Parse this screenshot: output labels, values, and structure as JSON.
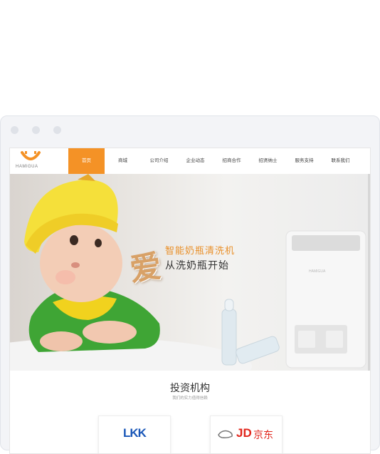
{
  "window": {
    "controls": [
      "close",
      "minimize",
      "maximize"
    ]
  },
  "logo": {
    "text": "HAMIGUA",
    "icon": "smile-logo-icon",
    "color": "#f49226"
  },
  "nav": {
    "items": [
      {
        "label": "首页",
        "active": true
      },
      {
        "label": "商城"
      },
      {
        "label": "公司介绍"
      },
      {
        "label": "企业动态"
      },
      {
        "label": "招商合作"
      },
      {
        "label": "招贤纳士"
      },
      {
        "label": "服务支持"
      },
      {
        "label": "联系我们"
      }
    ],
    "active_color": "#f49226"
  },
  "banner": {
    "love_char": "爱",
    "headline": "智能奶瓶清洗机",
    "subline": "从洗奶瓶开始",
    "machine_brand": "HAMIGUA"
  },
  "section": {
    "title": "投资机构",
    "subtitle": "我们的实力值得信赖"
  },
  "partners": [
    {
      "name": "LKK",
      "color": "#1a57b8"
    },
    {
      "name": "JD京东",
      "mark": "JD",
      "cn": "京东",
      "color": "#e1251b"
    }
  ]
}
